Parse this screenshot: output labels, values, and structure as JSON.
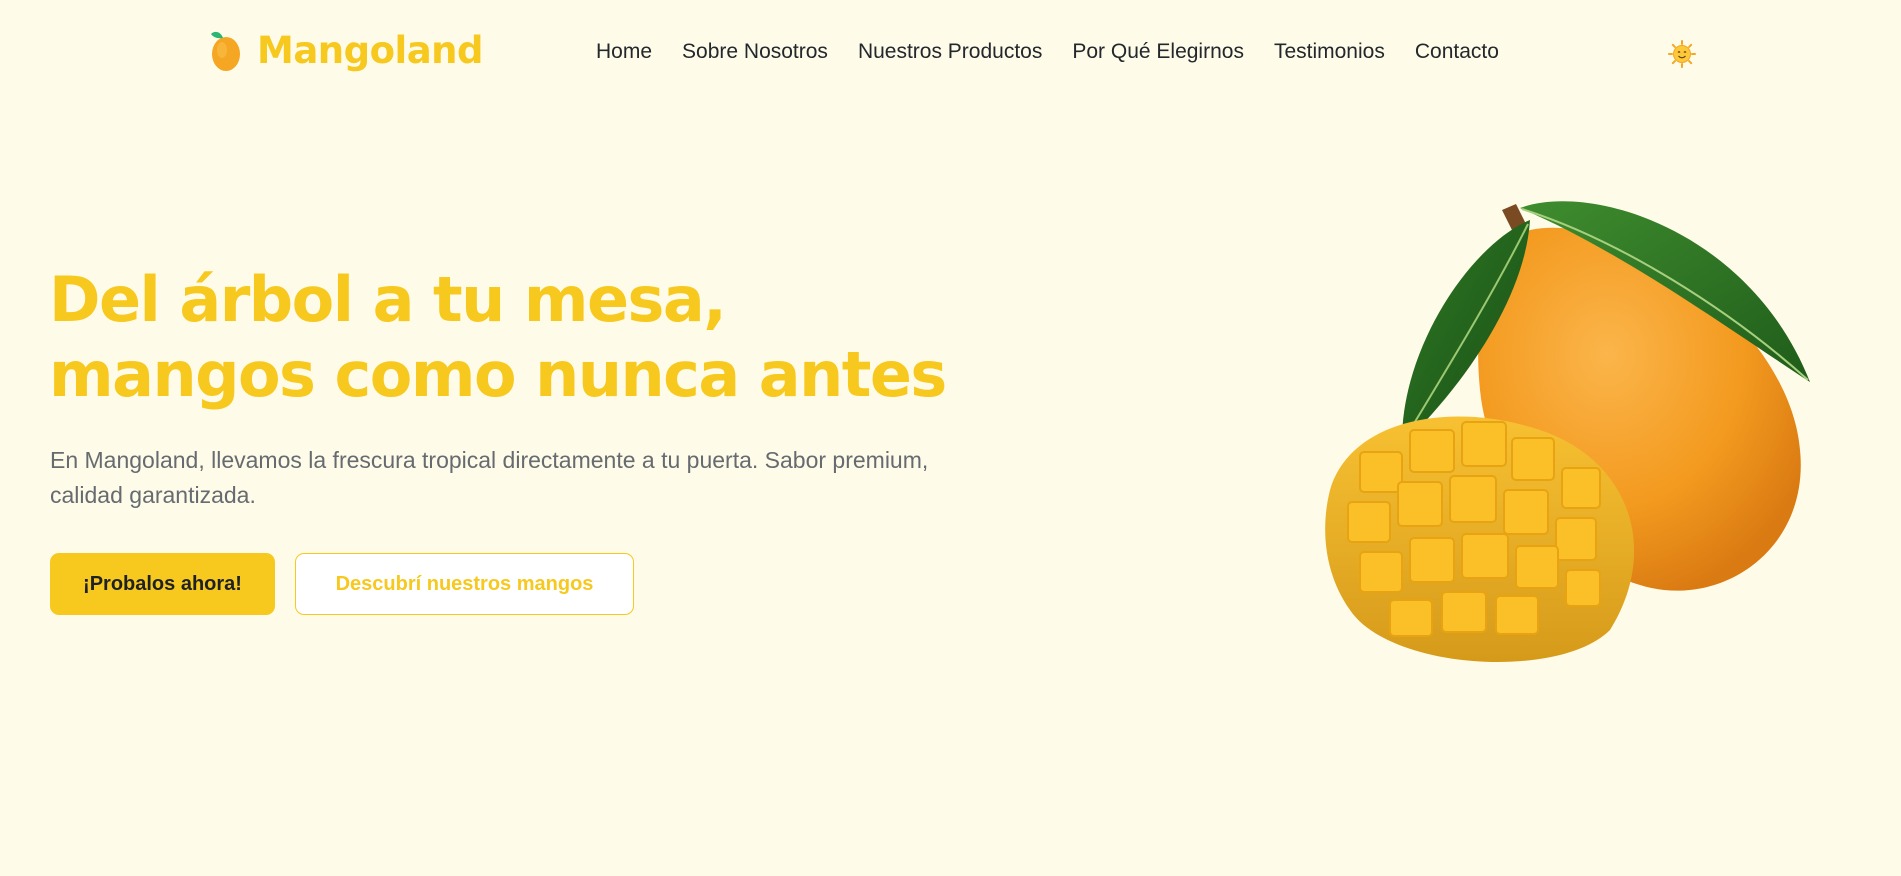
{
  "brand": {
    "name": "Mangoland",
    "color": "#f7c81e",
    "logo_icon": "mango-icon"
  },
  "nav": {
    "items": [
      {
        "label": "Home"
      },
      {
        "label": "Sobre Nosotros"
      },
      {
        "label": "Nuestros Productos"
      },
      {
        "label": "Por Qué Elegirnos"
      },
      {
        "label": "Testimonios"
      },
      {
        "label": "Contacto"
      }
    ],
    "theme_toggle_icon": "sun-face-icon"
  },
  "hero": {
    "title_line1": "Del árbol a tu mesa,",
    "title_line2": "mangos como nunca antes",
    "description": "En Mangoland, llevamos la frescura tropical directamente a tu puerta. Sabor premium, calidad garantizada.",
    "primary_button": "¡Probalos ahora!",
    "secondary_button": "Descubrí nuestros mangos",
    "image_icon": "mango-image"
  },
  "colors": {
    "background": "#fffbe9",
    "accent": "#f7c81e",
    "text_dark": "#23282d",
    "text_muted": "#666b70"
  }
}
